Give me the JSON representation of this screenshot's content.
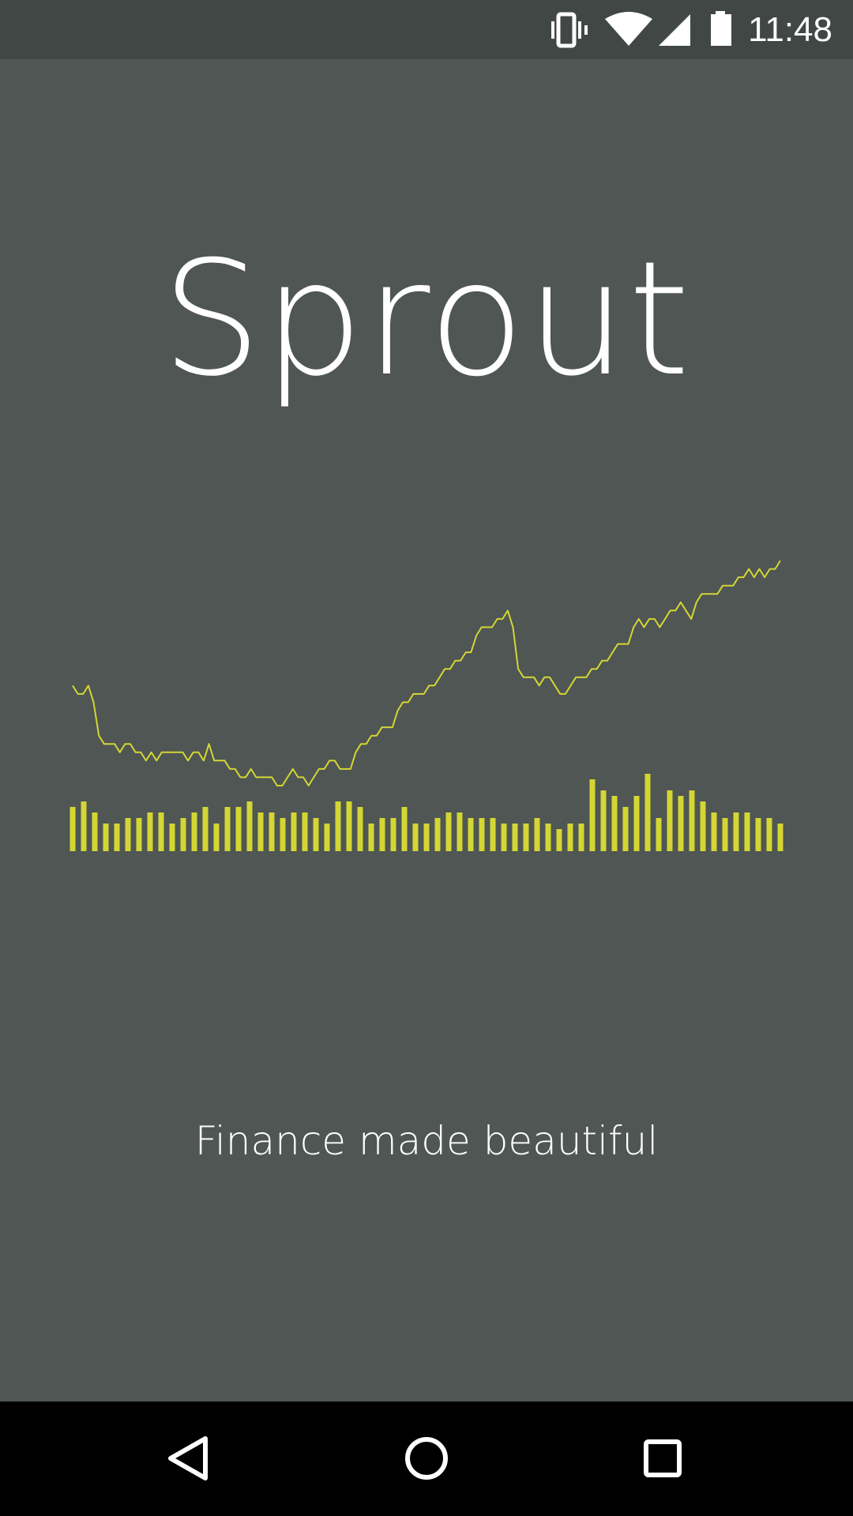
{
  "status_bar": {
    "time": "11:48",
    "icons": [
      "vibrate-icon",
      "wifi-icon",
      "cell-signal-icon",
      "battery-icon"
    ]
  },
  "app": {
    "title": "Sprout",
    "tagline": "Finance made beautiful",
    "background_color": "#4f5654",
    "accent_color": "#d4d633"
  },
  "nav_bar": {
    "buttons": [
      "back-icon",
      "home-icon",
      "recents-icon"
    ]
  },
  "chart_data": {
    "type": "line",
    "line_series": [
      12,
      11,
      11,
      12,
      10,
      6,
      5,
      5,
      5,
      4,
      5,
      5,
      4,
      4,
      3,
      4,
      3,
      4,
      4,
      4,
      4,
      4,
      3,
      4,
      4,
      3,
      5,
      3,
      3,
      3,
      2,
      2,
      1,
      1,
      2,
      1,
      1,
      1,
      1,
      0,
      0,
      1,
      2,
      1,
      1,
      0,
      1,
      2,
      2,
      3,
      3,
      2,
      2,
      2,
      4,
      5,
      5,
      6,
      6,
      7,
      7,
      7,
      9,
      10,
      10,
      11,
      11,
      11,
      12,
      12,
      13,
      14,
      14,
      15,
      15,
      16,
      16,
      18,
      19,
      19,
      19,
      20,
      20,
      21,
      19,
      14,
      13,
      13,
      13,
      12,
      13,
      13,
      12,
      11,
      11,
      12,
      13,
      13,
      13,
      14,
      14,
      15,
      15,
      16,
      17,
      17,
      17,
      19,
      20,
      19,
      20,
      20,
      19,
      20,
      21,
      21,
      22,
      21,
      20,
      22,
      23,
      23,
      23,
      23,
      24,
      24,
      24,
      25,
      25,
      26,
      25,
      26,
      25,
      26,
      26,
      27
    ],
    "volume_bars": [
      8,
      9,
      7,
      5,
      5,
      6,
      6,
      7,
      7,
      5,
      6,
      7,
      8,
      5,
      8,
      8,
      9,
      7,
      7,
      6,
      7,
      7,
      6,
      5,
      9,
      9,
      8,
      5,
      6,
      6,
      8,
      5,
      5,
      6,
      7,
      7,
      6,
      6,
      6,
      5,
      5,
      5,
      6,
      5,
      4,
      5,
      5,
      13,
      11,
      10,
      8,
      10,
      14,
      6,
      11,
      10,
      11,
      9,
      7,
      6,
      7,
      7,
      6,
      6,
      5
    ],
    "line_color": "#d4d633",
    "bar_color": "#d4d633"
  }
}
